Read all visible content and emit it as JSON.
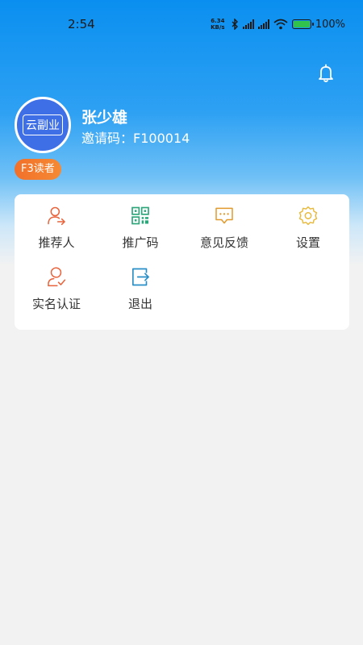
{
  "status_bar": {
    "time": "2:54",
    "net_speed_value": "6.34",
    "net_speed_unit": "KB/s",
    "battery_text": "100%"
  },
  "user": {
    "avatar_text": "云副业",
    "name": "张少雄",
    "invite_label": "邀请码：",
    "invite_code": "F100014",
    "level_badge": "F3读者"
  },
  "menu": {
    "items": [
      {
        "label": "推荐人",
        "icon": "user-arrow-icon",
        "color": "#e8623a"
      },
      {
        "label": "推广码",
        "icon": "qr-code-icon",
        "color": "#2aa67a"
      },
      {
        "label": "意见反馈",
        "icon": "chat-bubble-icon",
        "color": "#e29a2c"
      },
      {
        "label": "设置",
        "icon": "gear-icon",
        "color": "#e8b93a"
      },
      {
        "label": "实名认证",
        "icon": "user-check-icon",
        "color": "#e8623a"
      },
      {
        "label": "退出",
        "icon": "logout-icon",
        "color": "#2a8fc7"
      }
    ]
  },
  "colors": {
    "header_blue": "#0a8ff0",
    "avatar_blue": "#3f6fe6",
    "badge_orange": "#f2702a",
    "background": "#f2f2f2"
  }
}
